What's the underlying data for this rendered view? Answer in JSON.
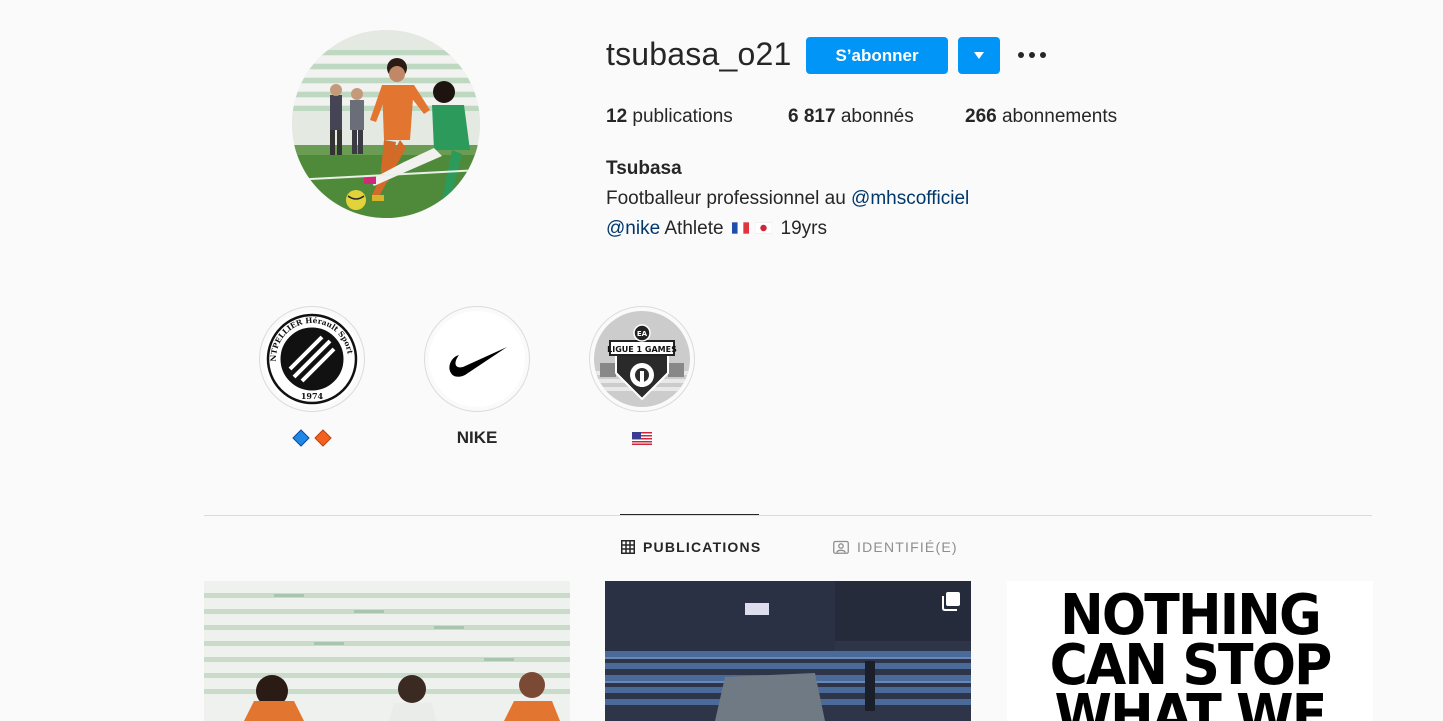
{
  "profile": {
    "username": "tsubasa_o21",
    "follow_label": "S’abonner",
    "avatar_icon": "profile-photo-footballer",
    "stats": {
      "posts_count": "12",
      "posts_label": "publications",
      "followers_count": "6 817",
      "followers_label": "abonnés",
      "following_count": "266",
      "following_label": "abonnements"
    },
    "full_name": "Tsubasa",
    "bio_line1_text": "Footballeur professionnel au ",
    "bio_line1_mention": "@mhscofficiel",
    "bio_line2_mention": "@nike",
    "bio_line2_text": " Athlete",
    "bio_line2_flags": [
      "france-flag-icon",
      "japan-flag-icon"
    ],
    "bio_line2_suffix": "19yrs"
  },
  "highlights": [
    {
      "label": "",
      "label_icons": [
        "blue-diamond-icon",
        "orange-diamond-icon"
      ],
      "cover": "montpellier-herault-sport-club-logo",
      "cover_text": [
        "MONTPELLIER Hérault Sport Club",
        "1974"
      ]
    },
    {
      "label": "NIKE",
      "cover": "nike-swoosh-logo"
    },
    {
      "label": "",
      "label_icons": [
        "us-flag-icon"
      ],
      "cover": "ligue-1-games-logo",
      "cover_text": [
        "EA",
        "LIGUE 1 GAMES"
      ]
    }
  ],
  "tabs": [
    {
      "label": "PUBLICATIONS",
      "icon": "grid-icon",
      "active": true
    },
    {
      "label": "IDENTIFIÉ(E)",
      "icon": "tagged-icon",
      "active": false
    }
  ],
  "posts": [
    {
      "kind": "photo",
      "subject": "footballers-on-pitch"
    },
    {
      "kind": "carousel",
      "subject": "stadium-stands",
      "icon": "multiple-photos-icon"
    },
    {
      "kind": "text-graphic",
      "text_lines": [
        "NOTHING",
        "CAN STOP",
        "WHAT WE"
      ]
    }
  ],
  "colors": {
    "accent": "#0095f6",
    "mention": "#00376b",
    "text": "#262626",
    "muted": "#8e8e8e",
    "background": "#fafafa",
    "border": "#dbdbdb"
  }
}
